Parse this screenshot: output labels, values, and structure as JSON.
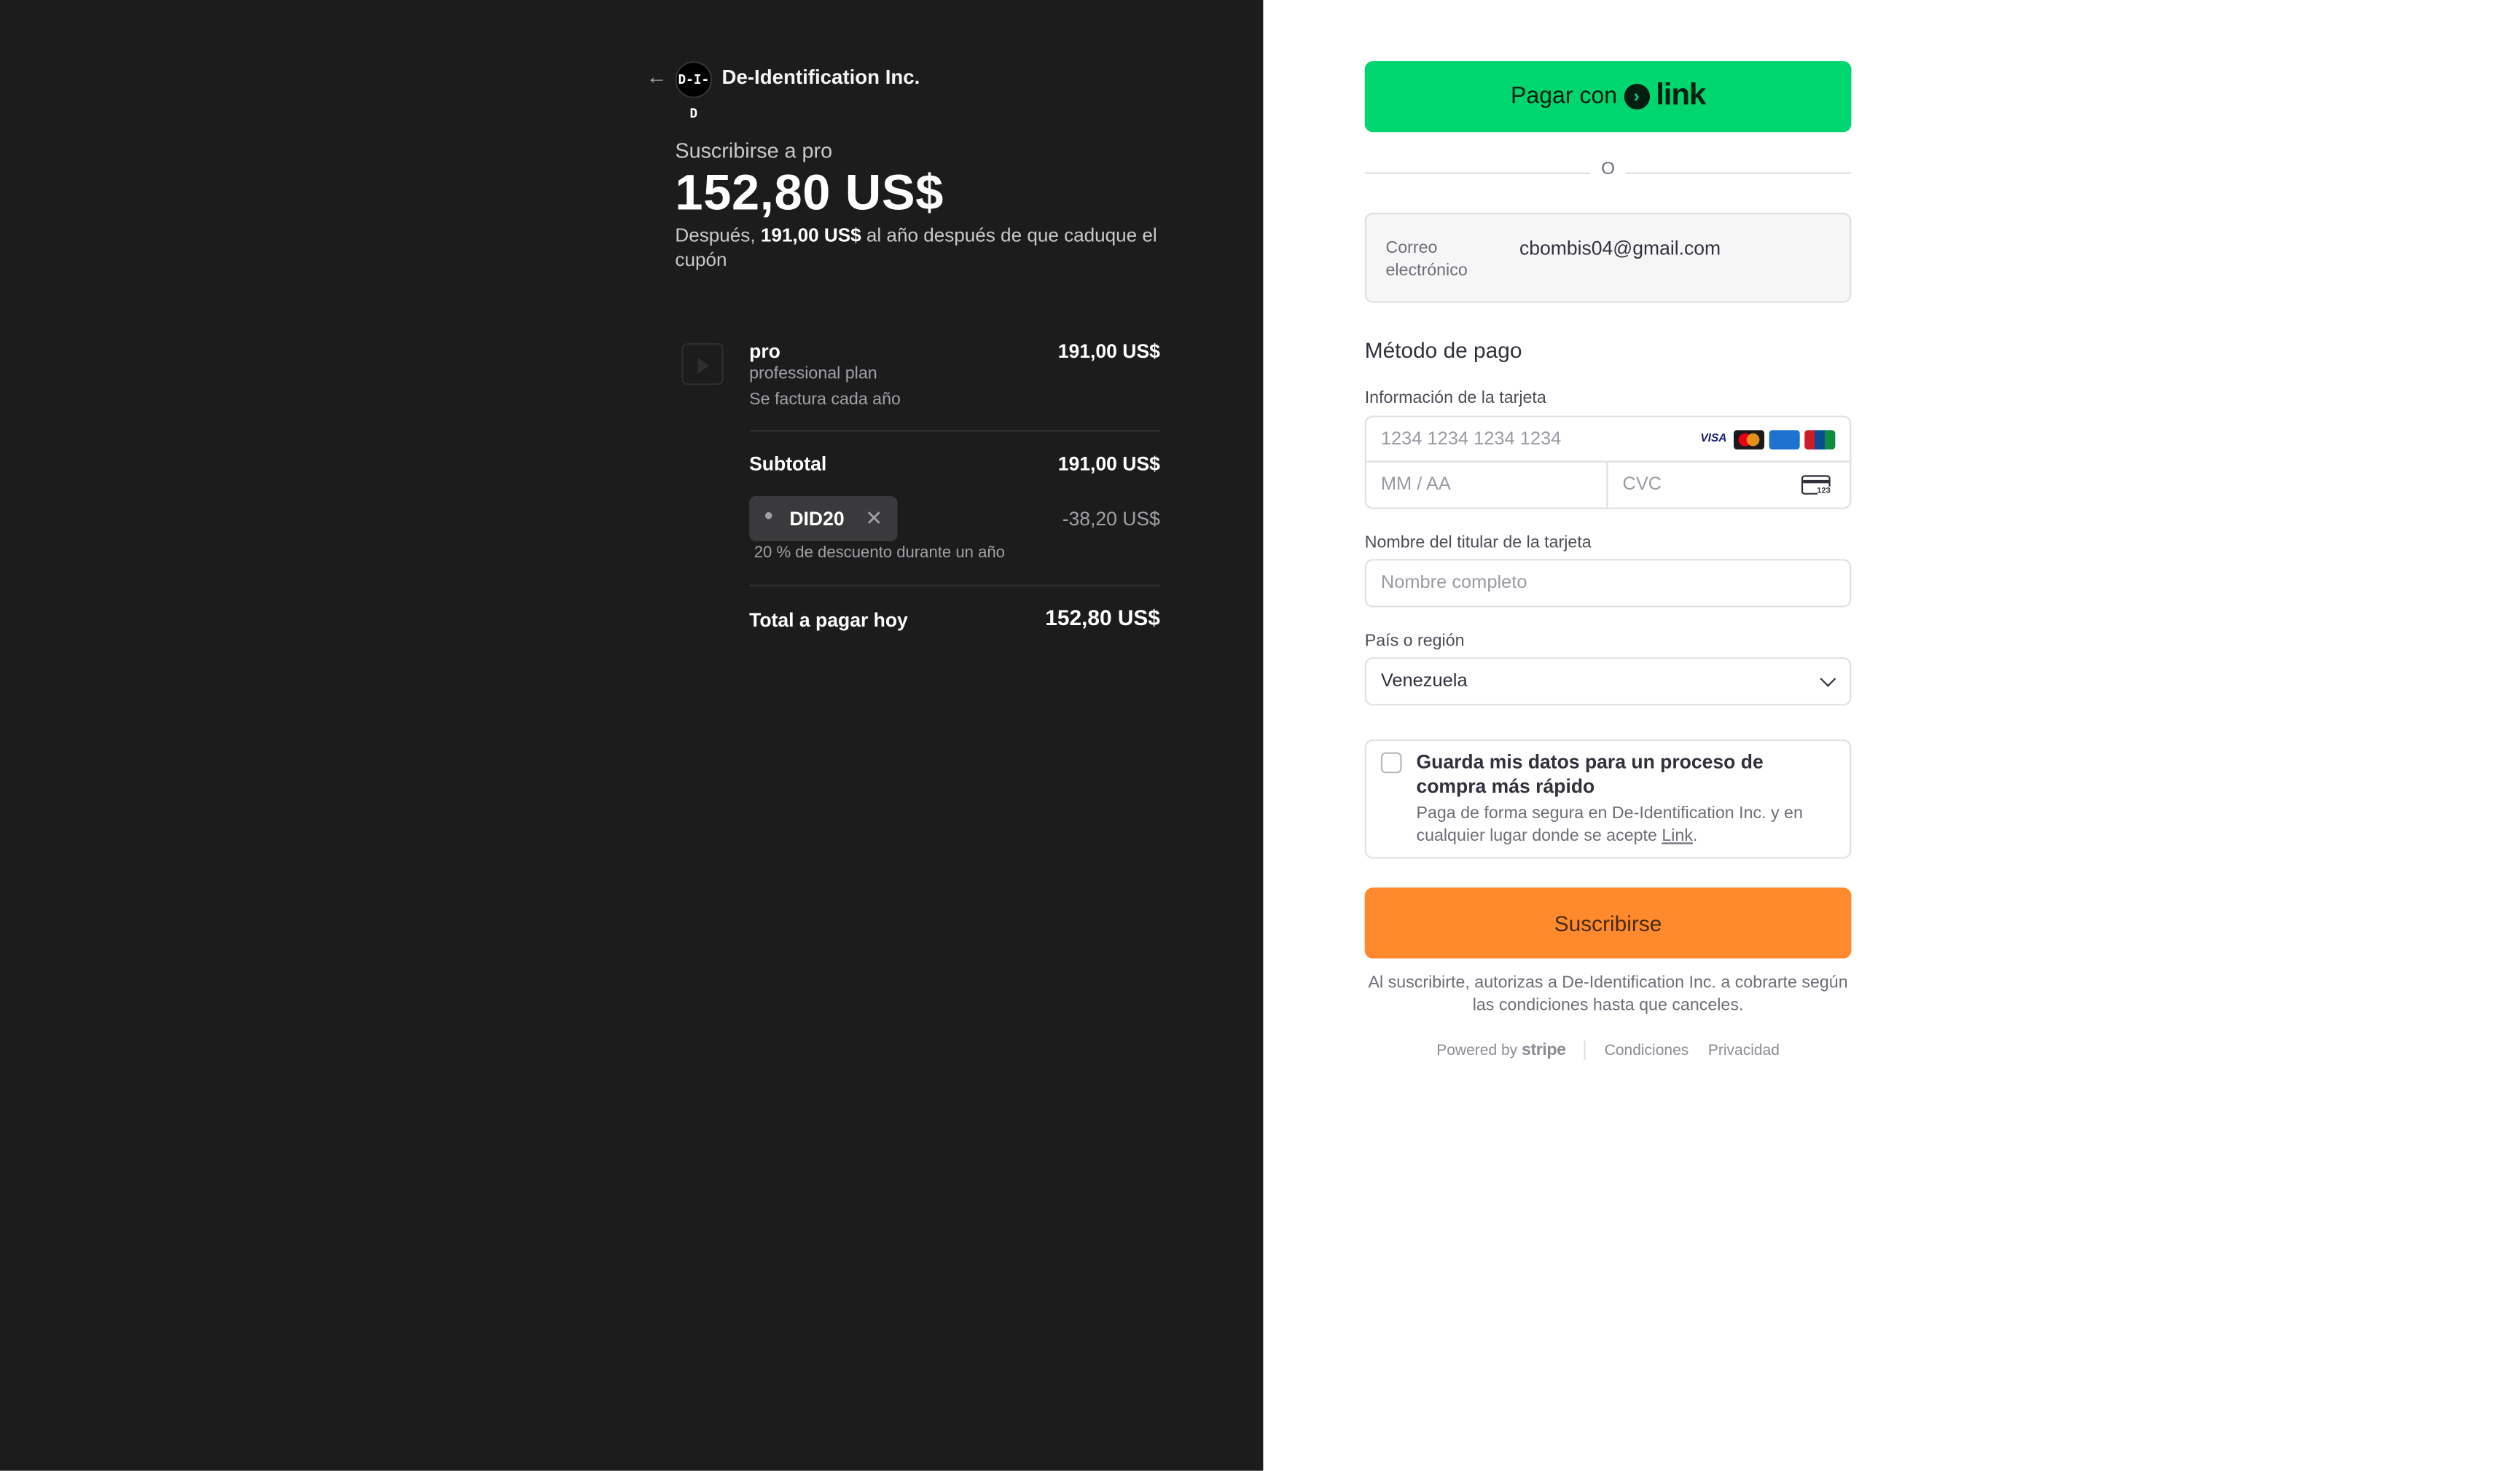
{
  "merchant": {
    "name": "De-Identification Inc.",
    "logo_text": "D-I-D"
  },
  "summary": {
    "subscribe_label": "Suscribirse a pro",
    "price": "152,80 US$",
    "after_prefix": "Después, ",
    "after_amount": "191,00 US$",
    "after_suffix": " al año después de que caduque el cupón"
  },
  "line_item": {
    "name": "pro",
    "description": "professional plan",
    "billing": "Se factura cada año",
    "price": "191,00 US$"
  },
  "subtotal": {
    "label": "Subtotal",
    "value": "191,00 US$"
  },
  "promo": {
    "code": "DID20",
    "discount": "-38,20 US$",
    "description": "20 % de descuento durante un año"
  },
  "total": {
    "label": "Total a pagar hoy",
    "value": "152,80 US$"
  },
  "link_button": {
    "label": "Pagar con",
    "brand": "link"
  },
  "or_text": "O",
  "email": {
    "label": "Correo electrónico",
    "value": "cbombis04@gmail.com"
  },
  "payment": {
    "title": "Método de pago",
    "card_label": "Información de la tarjeta",
    "card_placeholder": "1234 1234 1234 1234",
    "exp_placeholder": "MM / AA",
    "cvc_placeholder": "CVC",
    "card_brands": [
      "VISA",
      "mastercard",
      "AMEX",
      "UnionPay"
    ]
  },
  "cardholder": {
    "label": "Nombre del titular de la tarjeta",
    "placeholder": "Nombre completo"
  },
  "country": {
    "label": "País o región",
    "selected": "Venezuela"
  },
  "save_info": {
    "title": "Guarda mis datos para un proceso de compra más rápido",
    "desc_prefix": "Paga de forma segura en De-Identification Inc. y en cualquier lugar donde se acepte ",
    "desc_link": "Link",
    "desc_suffix": "."
  },
  "subscribe_button": "Suscribirse",
  "legal": "Al suscribirte, autorizas a De-Identification Inc. a cobrarte según las condiciones hasta que canceles.",
  "footer": {
    "powered_by": "Powered by",
    "stripe": "stripe",
    "terms": "Condiciones",
    "privacy": "Privacidad"
  },
  "colors": {
    "left_bg": "#1c1c1d",
    "link_green": "#00d66f",
    "subscribe_orange": "#ff8a2e"
  }
}
